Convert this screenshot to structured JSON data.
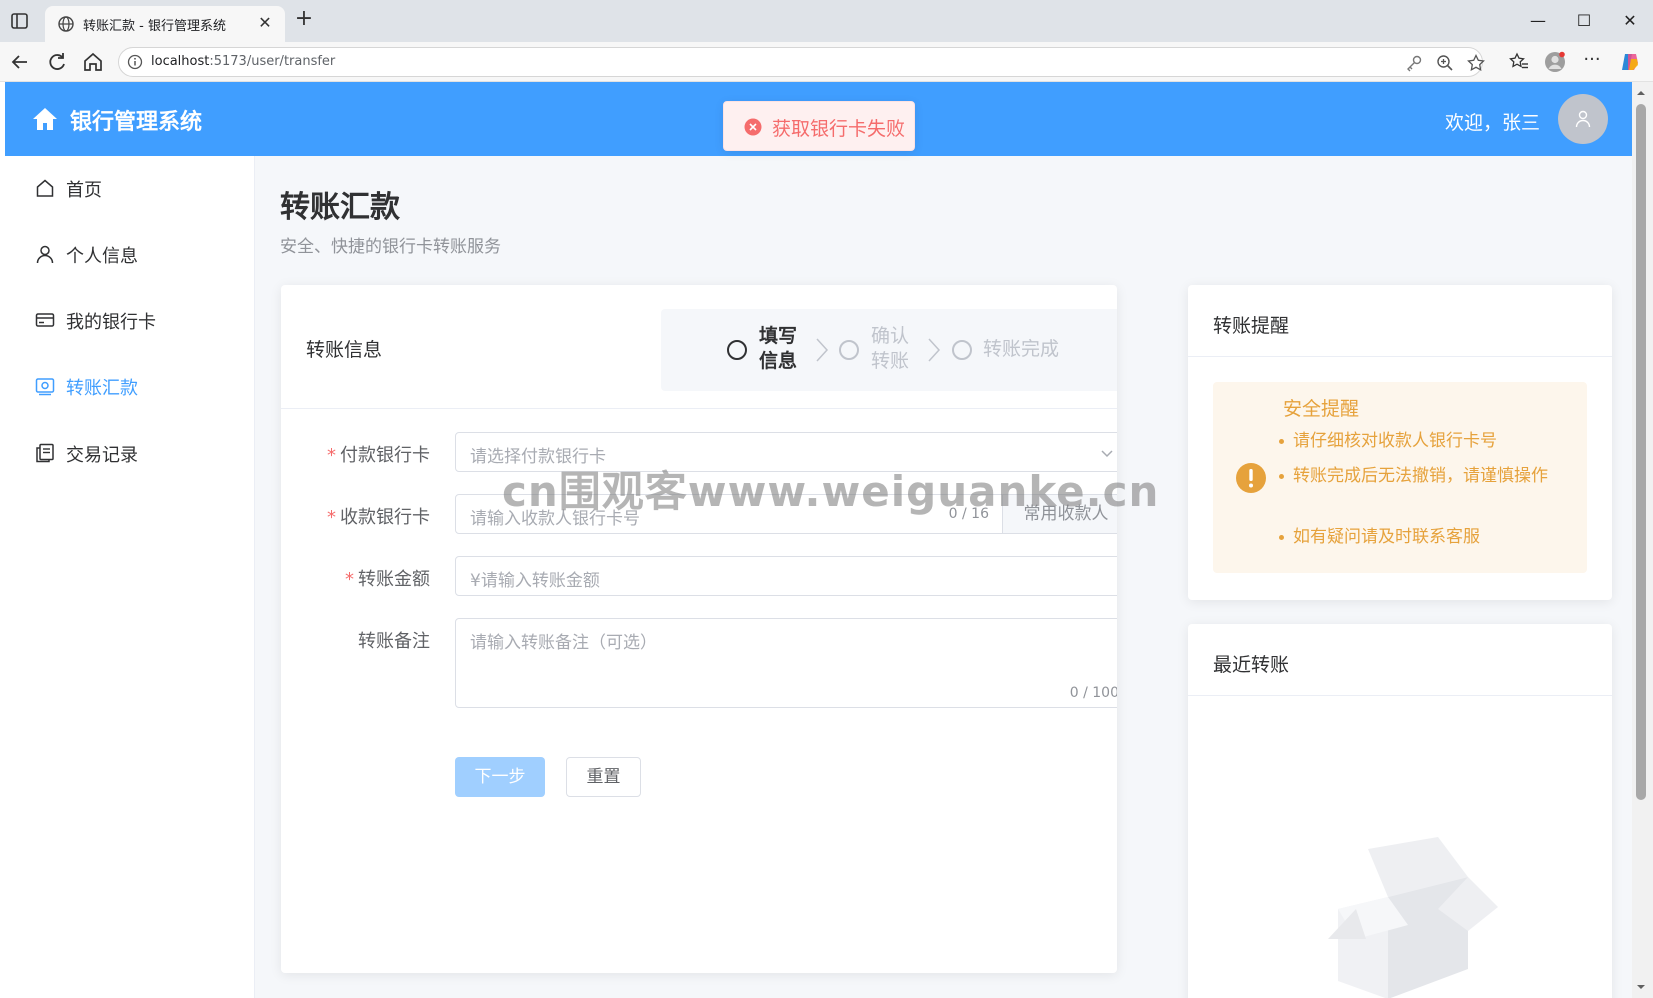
{
  "browser": {
    "tab_title": "转账汇款 - 银行管理系统",
    "url_host": "localhost",
    "url_path": ":5173/user/transfer"
  },
  "header": {
    "logo_text": "银行管理系统",
    "welcome": "欢迎，张三"
  },
  "toast": {
    "message": "获取银行卡失败"
  },
  "sidebar": {
    "items": [
      {
        "label": "首页",
        "icon": "home-icon"
      },
      {
        "label": "个人信息",
        "icon": "user-icon"
      },
      {
        "label": "我的银行卡",
        "icon": "credit-card-icon"
      },
      {
        "label": "转账汇款",
        "icon": "transfer-icon",
        "active": true
      },
      {
        "label": "交易记录",
        "icon": "document-icon"
      }
    ]
  },
  "page": {
    "title": "转账汇款",
    "subtitle": "安全、快捷的银行卡转账服务"
  },
  "transfer_card": {
    "title": "转账信息",
    "steps": [
      {
        "label": "填写信息",
        "line1": "填写",
        "line2": "信息",
        "active": true
      },
      {
        "label": "确认转账",
        "line1": "确认",
        "line2": "转账",
        "active": false
      },
      {
        "label": "转账完成",
        "line1": "转账完成",
        "line2": "",
        "active": false
      }
    ],
    "form": {
      "payer_label": "付款银行卡",
      "payer_placeholder": "请选择付款银行卡",
      "payee_label": "收款银行卡",
      "payee_placeholder": "请输入收款人银行卡号",
      "payee_counter": "0 / 16",
      "payee_append": "常用收款人",
      "amount_label": "转账金额",
      "amount_placeholder": "¥请输入转账金额",
      "note_label": "转账备注",
      "note_placeholder": "请输入转账备注（可选）",
      "note_counter": "0 / 100",
      "required_mark": "*"
    },
    "next_button": "下一步",
    "reset_button": "重置"
  },
  "reminder_card": {
    "title": "转账提醒",
    "alert_title": "安全提醒",
    "items": [
      "请仔细核对收款人银行卡号",
      "转账完成后无法撤销，请谨慎操作",
      "如有疑问请及时联系客服"
    ]
  },
  "recent_card": {
    "title": "最近转账"
  },
  "watermark": "cn围观客www.weiguanke.cn",
  "colors": {
    "primary": "#409eff",
    "danger": "#f56c6c",
    "warning": "#e6a23c"
  }
}
